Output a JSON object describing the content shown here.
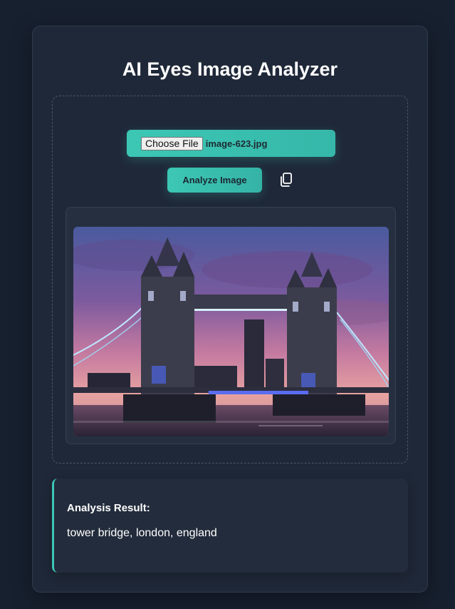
{
  "app": {
    "title": "AI Eyes Image Analyzer"
  },
  "upload": {
    "choose_label": "Choose File",
    "file_name": "image-623.jpg",
    "analyze_label": "Analyze Image",
    "copy_icon": "copy-icon"
  },
  "preview": {
    "image_subject": "Tower Bridge at dusk"
  },
  "result": {
    "heading": "Analysis Result:",
    "text": "tower bridge, london, england"
  },
  "colors": {
    "accent": "#3cc7b4",
    "background": "#17202f",
    "card": "#1f2838"
  }
}
